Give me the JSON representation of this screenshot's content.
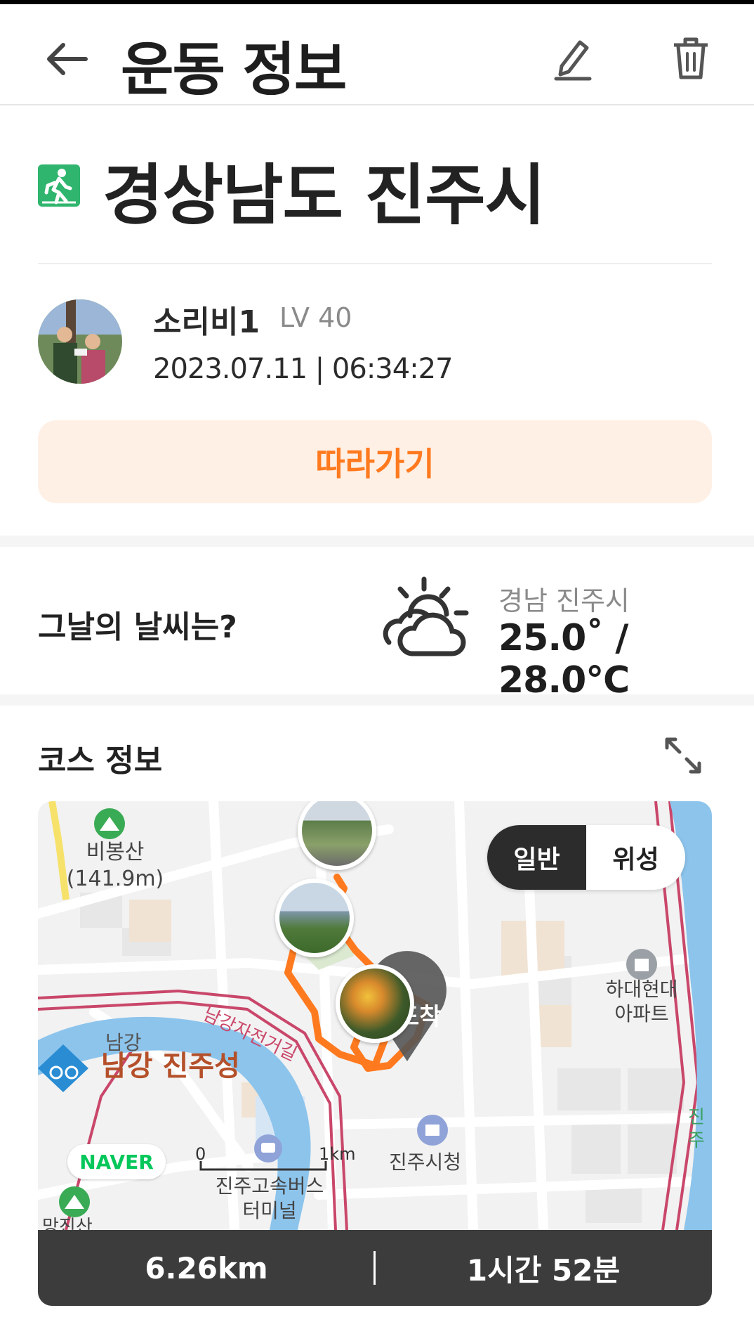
{
  "header": {
    "title": "운동 정보"
  },
  "activity": {
    "location": "경상남도 진주시",
    "user_name": "소리비1",
    "level": "LV 40",
    "datetime": "2023.07.11 | 06:34:27",
    "follow_label": "따라가기"
  },
  "weather": {
    "question": "그날의 날씨는?",
    "location": "경남 진주시",
    "temperature": "25.0˚ / 28.0℃",
    "icon": "partly-cloudy-icon"
  },
  "course": {
    "title": "코스 정보",
    "map_toggle": {
      "normal": "일반",
      "satellite": "위성",
      "selected": "일반"
    },
    "map_labels": {
      "mountain_name": "비봉산",
      "mountain_height": "(141.9m)",
      "apartment_line1": "하대현대",
      "apartment_line2": "아파트",
      "river": "남강",
      "fortress": "남강 진주성",
      "bike_road": "남강자전거길",
      "city_hall": "진주시청",
      "bus_terminal_line1": "진주고속버스",
      "bus_terminal_line2": "터미널",
      "arrival": "도착",
      "edge_right": "진주",
      "edge_bottom": "망진산",
      "naver": "NAVER",
      "scale_zero": "0",
      "scale_one": "1km"
    },
    "distance": "6.26km",
    "duration": "1시간 52분"
  },
  "colors": {
    "route": "#ff7a1f",
    "follow_bg": "#fff0e6",
    "walk_badge": "#2fb56d",
    "naver_green": "#03c75a",
    "summary_bg": "#3c3c3c"
  }
}
